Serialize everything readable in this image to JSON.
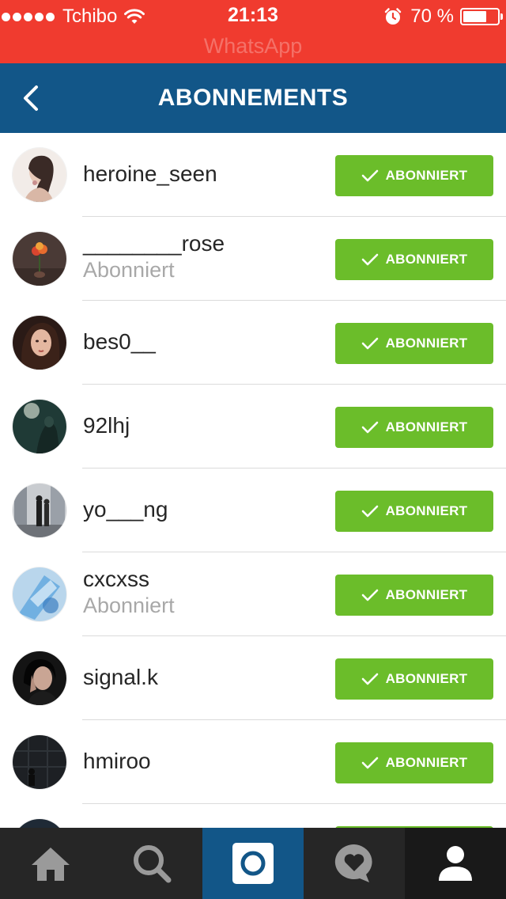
{
  "status_bar": {
    "carrier": "Tchibo",
    "time": "21:13",
    "battery_percent": "70 %",
    "battery_level": 0.7,
    "back_to_app": "WhatsApp"
  },
  "nav": {
    "title": "ABONNEMENTS",
    "back_icon": "chevron-left-icon"
  },
  "colors": {
    "status_bar": "#f03b2f",
    "nav_bar": "#125688",
    "follow_button": "#6bbd2a",
    "tab_bar": "#262626"
  },
  "following": [
    {
      "username": "heroine_seen",
      "subtitle": "",
      "button": "ABONNIERT"
    },
    {
      "username": "________rose",
      "subtitle": "Abonniert",
      "button": "ABONNIERT"
    },
    {
      "username": "bes0__",
      "subtitle": "",
      "button": "ABONNIERT"
    },
    {
      "username": "92lhj",
      "subtitle": "",
      "button": "ABONNIERT"
    },
    {
      "username": "yo___ng",
      "subtitle": "",
      "button": "ABONNIERT"
    },
    {
      "username": "cxcxss",
      "subtitle": "Abonniert",
      "button": "ABONNIERT"
    },
    {
      "username": "signal.k",
      "subtitle": "",
      "button": "ABONNIERT"
    },
    {
      "username": "hmiroo",
      "subtitle": "",
      "button": "ABONNIERT"
    },
    {
      "username": "",
      "subtitle": "",
      "button": ""
    }
  ],
  "tabs": [
    {
      "icon": "home-icon",
      "active": false
    },
    {
      "icon": "search-icon",
      "active": false
    },
    {
      "icon": "camera-icon",
      "active": true
    },
    {
      "icon": "activity-heart-icon",
      "active": false
    },
    {
      "icon": "profile-icon",
      "active": false
    }
  ]
}
